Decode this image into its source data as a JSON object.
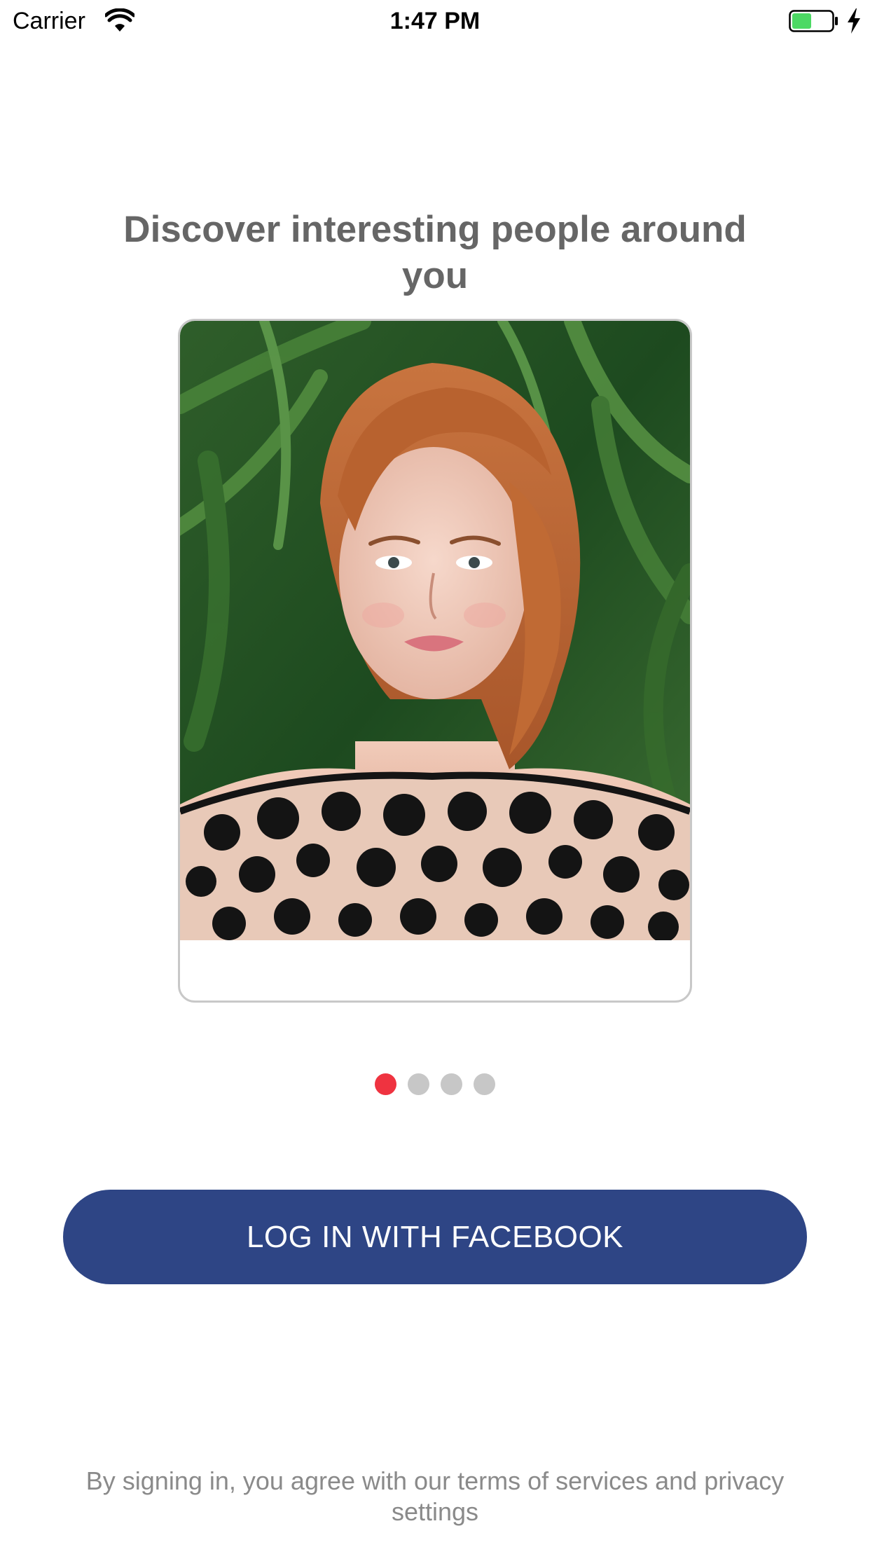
{
  "status_bar": {
    "carrier": "Carrier",
    "time": "1:47 PM",
    "wifi_icon": "wifi-icon",
    "battery_icon": "battery-charging-icon",
    "battery_color": "#4cd964"
  },
  "onboarding": {
    "headline": "Discover interesting people around you",
    "card": {
      "photo_icon": "profile-photo",
      "caption": ""
    },
    "pager": {
      "total": 4,
      "active_index": 0,
      "active_color": "#ef3340",
      "inactive_color": "#c7c7c7"
    }
  },
  "actions": {
    "facebook_login_label": "LOG IN WITH FACEBOOK",
    "facebook_color": "#2e4585"
  },
  "footer": {
    "legal_text": "By signing in, you agree with our terms of services and privacy settings"
  }
}
